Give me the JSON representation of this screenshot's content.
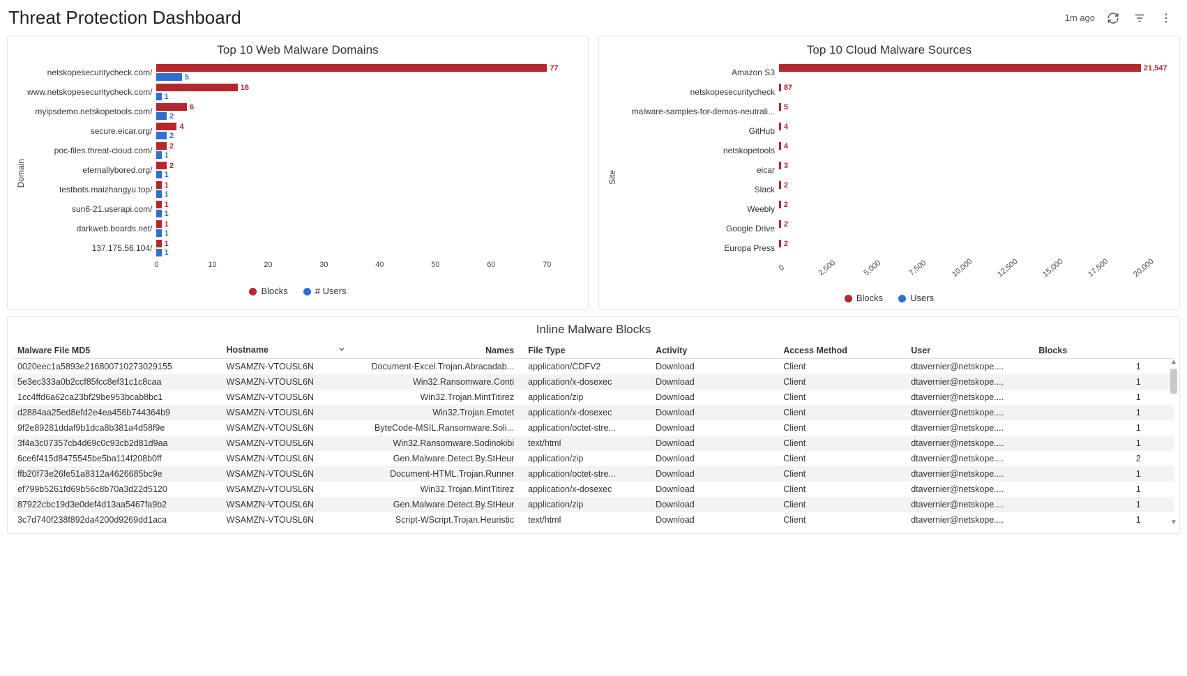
{
  "header": {
    "title": "Threat Protection Dashboard",
    "last_refresh": "1m ago"
  },
  "colors": {
    "blocks": "#b3282d",
    "users": "#2f6fd0"
  },
  "chart_data": [
    {
      "type": "bar",
      "orientation": "horizontal",
      "title": "Top 10 Web Malware Domains",
      "ylabel": "Domain",
      "categories": [
        "netskopesecuritycheck.com/",
        "www.netskopesecuritycheck.com/",
        "myipsdemo.netskopetools.com/",
        "secure.eicar.org/",
        "poc-files.threat-cloud.com/",
        "eternallybored.org/",
        "testbots.maizhangyu.top/",
        "sun6-21.userapi.com/",
        "darkweb.boards.net/",
        "137.175.56.104/"
      ],
      "series": [
        {
          "name": "Blocks",
          "color": "#b3282d",
          "values": [
            77,
            16,
            6,
            4,
            2,
            2,
            1,
            1,
            1,
            1
          ]
        },
        {
          "name": "# Users",
          "color": "#2f6fd0",
          "values": [
            5,
            1,
            2,
            2,
            1,
            1,
            1,
            1,
            1,
            1
          ]
        }
      ],
      "legend": [
        "Blocks",
        "# Users"
      ],
      "x_ticks": [
        0,
        10,
        20,
        30,
        40,
        50,
        60,
        70
      ],
      "xlim": [
        0,
        77
      ]
    },
    {
      "type": "bar",
      "orientation": "horizontal",
      "title": "Top 10 Cloud Malware Sources",
      "ylabel": "Site",
      "categories": [
        "Amazon S3",
        "netskopesecuritycheck",
        "malware-samples-for-demos-neutrali...",
        "GitHub",
        "netskopetools",
        "eicar",
        "Slack",
        "Weebly",
        "Google Drive",
        "Europa Press"
      ],
      "series": [
        {
          "name": "Blocks",
          "color": "#b3282d",
          "values": [
            21547,
            87,
            5,
            4,
            4,
            3,
            2,
            2,
            2,
            2
          ]
        },
        {
          "name": "Users",
          "color": "#2f6fd0",
          "values": [
            null,
            null,
            null,
            null,
            null,
            null,
            null,
            null,
            null,
            null
          ]
        }
      ],
      "legend": [
        "Blocks",
        "Users"
      ],
      "x_ticks": [
        0,
        2500,
        5000,
        7500,
        10000,
        12500,
        15000,
        17500,
        20000
      ],
      "x_tick_labels": [
        "0",
        "2,500",
        "5,000",
        "7,500",
        "10,000",
        "12,500",
        "15,000",
        "17,500",
        "20,000"
      ],
      "xlim": [
        0,
        21547
      ]
    }
  ],
  "table": {
    "title": "Inline Malware Blocks",
    "columns": [
      "Malware File MD5",
      "Hostname",
      "Names",
      "File Type",
      "Activity",
      "Access Method",
      "User",
      "Blocks"
    ],
    "sorted_column": "Hostname",
    "rows": [
      {
        "md5": "0020eec1a5893e216800710273029155",
        "host": "WSAMZN-VTOUSL6N",
        "names": "Document-Excel.Trojan.Abracadab...",
        "ftype": "application/CDFV2",
        "activity": "Download",
        "access": "Client",
        "user": "dtavernier@netskope....",
        "blocks": 1
      },
      {
        "md5": "5e3ec333a0b2ccf85fcc8ef31c1c8caa",
        "host": "WSAMZN-VTOUSL6N",
        "names": "Win32.Ransomware.Conti",
        "ftype": "application/x-dosexec",
        "activity": "Download",
        "access": "Client",
        "user": "dtavernier@netskope....",
        "blocks": 1
      },
      {
        "md5": "1cc4ffd6a62ca23bf29be953bcab8bc1",
        "host": "WSAMZN-VTOUSL6N",
        "names": "Win32.Trojan.MintTitirez",
        "ftype": "application/zip",
        "activity": "Download",
        "access": "Client",
        "user": "dtavernier@netskope....",
        "blocks": 1
      },
      {
        "md5": "d2884aa25ed8efd2e4ea456b744364b9",
        "host": "WSAMZN-VTOUSL6N",
        "names": "Win32.Trojan.Emotet",
        "ftype": "application/x-dosexec",
        "activity": "Download",
        "access": "Client",
        "user": "dtavernier@netskope....",
        "blocks": 1
      },
      {
        "md5": "9f2e89281ddaf9b1dca8b381a4d58f9e",
        "host": "WSAMZN-VTOUSL6N",
        "names": "ByteCode-MSIL.Ransomware.Soli...",
        "ftype": "application/octet-stre...",
        "activity": "Download",
        "access": "Client",
        "user": "dtavernier@netskope....",
        "blocks": 1
      },
      {
        "md5": "3f4a3c07357cb4d69c0c93cb2d81d9aa",
        "host": "WSAMZN-VTOUSL6N",
        "names": "Win32.Ransomware.Sodinokibi",
        "ftype": "text/html",
        "activity": "Download",
        "access": "Client",
        "user": "dtavernier@netskope....",
        "blocks": 1
      },
      {
        "md5": "6ce6f415d8475545be5ba114f208b0ff",
        "host": "WSAMZN-VTOUSL6N",
        "names": "Gen.Malware.Detect.By.StHeur",
        "ftype": "application/zip",
        "activity": "Download",
        "access": "Client",
        "user": "dtavernier@netskope....",
        "blocks": 2
      },
      {
        "md5": "ffb20f73e26fe51a8312a4626685bc9e",
        "host": "WSAMZN-VTOUSL6N",
        "names": "Document-HTML.Trojan.Runner",
        "ftype": "application/octet-stre...",
        "activity": "Download",
        "access": "Client",
        "user": "dtavernier@netskope....",
        "blocks": 1
      },
      {
        "md5": "ef799b5261fd69b56c8b70a3d22d5120",
        "host": "WSAMZN-VTOUSL6N",
        "names": "Win32.Trojan.MintTitirez",
        "ftype": "application/x-dosexec",
        "activity": "Download",
        "access": "Client",
        "user": "dtavernier@netskope....",
        "blocks": 1
      },
      {
        "md5": "87922cbc19d3e0def4d13aa5467fa9b2",
        "host": "WSAMZN-VTOUSL6N",
        "names": "Gen.Malware.Detect.By.StHeur",
        "ftype": "application/zip",
        "activity": "Download",
        "access": "Client",
        "user": "dtavernier@netskope....",
        "blocks": 1
      },
      {
        "md5": "3c7d740f238f892da4200d9269dd1aca",
        "host": "WSAMZN-VTOUSL6N",
        "names": "Script-WScript.Trojan.Heuristic",
        "ftype": "text/html",
        "activity": "Download",
        "access": "Client",
        "user": "dtavernier@netskope....",
        "blocks": 1
      }
    ]
  }
}
